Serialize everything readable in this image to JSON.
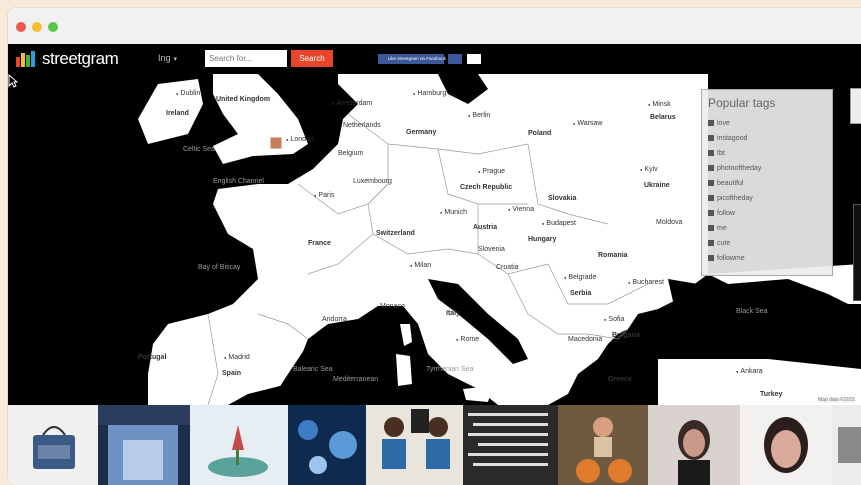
{
  "app": {
    "name": "streetgram",
    "language": "Ing",
    "search_placeholder": "Search for...",
    "search_button": "Search",
    "facebook_like": "Like streetgram on Facebook",
    "logo_colors": [
      "#e8452c",
      "#f5bf33",
      "#3bb54a",
      "#2d9cdb"
    ]
  },
  "tags_panel": {
    "title": "Popular tags",
    "tags": [
      "love",
      "instagood",
      "tbt",
      "photooftheday",
      "beautiful",
      "picoftheday",
      "follow",
      "me",
      "cute",
      "followme"
    ]
  },
  "map": {
    "labels": [
      {
        "text": "Dublin",
        "kind": "city"
      },
      {
        "text": "Ireland",
        "kind": "country"
      },
      {
        "text": "United Kingdom",
        "kind": "country"
      },
      {
        "text": "Amsterdam",
        "kind": "city"
      },
      {
        "text": "Hamburg",
        "kind": "city"
      },
      {
        "text": "Berlin",
        "kind": "city"
      },
      {
        "text": "Warsaw",
        "kind": "city"
      },
      {
        "text": "Minsk",
        "kind": "city"
      },
      {
        "text": "Belarus",
        "kind": "country"
      },
      {
        "text": "Germany",
        "kind": "country"
      },
      {
        "text": "Poland",
        "kind": "country"
      },
      {
        "text": "Netherlands",
        "kind": "country"
      },
      {
        "text": "Belgium",
        "kind": "country"
      },
      {
        "text": "Celtic Sea",
        "kind": "sea"
      },
      {
        "text": "London",
        "kind": "city"
      },
      {
        "text": "English Channel",
        "kind": "sea"
      },
      {
        "text": "Luxembourg",
        "kind": "country"
      },
      {
        "text": "Prague",
        "kind": "city"
      },
      {
        "text": "Czech Republic",
        "kind": "country"
      },
      {
        "text": "Kyiv",
        "kind": "city"
      },
      {
        "text": "Ukraine",
        "kind": "country"
      },
      {
        "text": "Paris",
        "kind": "city"
      },
      {
        "text": "Slovakia",
        "kind": "country"
      },
      {
        "text": "Munich",
        "kind": "city"
      },
      {
        "text": "Vienna",
        "kind": "city"
      },
      {
        "text": "Austria",
        "kind": "country"
      },
      {
        "text": "Budapest",
        "kind": "city"
      },
      {
        "text": "Moldova",
        "kind": "country"
      },
      {
        "text": "France",
        "kind": "country"
      },
      {
        "text": "Switzerland",
        "kind": "country"
      },
      {
        "text": "Hungary",
        "kind": "country"
      },
      {
        "text": "Slovenia",
        "kind": "country"
      },
      {
        "text": "Croatia",
        "kind": "country"
      },
      {
        "text": "Romania",
        "kind": "country"
      },
      {
        "text": "Bay of Biscay",
        "kind": "sea"
      },
      {
        "text": "Milan",
        "kind": "city"
      },
      {
        "text": "Belgrade",
        "kind": "city"
      },
      {
        "text": "Bucharest",
        "kind": "city"
      },
      {
        "text": "Serbia",
        "kind": "country"
      },
      {
        "text": "Monaco",
        "kind": "country"
      },
      {
        "text": "Andorra",
        "kind": "country"
      },
      {
        "text": "Italy",
        "kind": "country"
      },
      {
        "text": "Sofia",
        "kind": "city"
      },
      {
        "text": "Black Sea",
        "kind": "sea"
      },
      {
        "text": "Bulgaria",
        "kind": "country"
      },
      {
        "text": "Rome",
        "kind": "city"
      },
      {
        "text": "Macedonia",
        "kind": "country"
      },
      {
        "text": "Portugal",
        "kind": "country"
      },
      {
        "text": "Madrid",
        "kind": "city"
      },
      {
        "text": "Spain",
        "kind": "country"
      },
      {
        "text": "Balearic Sea",
        "kind": "sea"
      },
      {
        "text": "Tyrrhenian Sea",
        "kind": "sea"
      },
      {
        "text": "Mediterranean",
        "kind": "sea"
      },
      {
        "text": "Ankara",
        "kind": "city"
      },
      {
        "text": "Turkey",
        "kind": "country"
      },
      {
        "text": "Greece",
        "kind": "country"
      }
    ],
    "attribution": "Map data ©2015"
  },
  "photos": [
    {
      "subject": "handbag"
    },
    {
      "subject": "ice sculpture"
    },
    {
      "subject": "rose on plate"
    },
    {
      "subject": "blue crystals"
    },
    {
      "subject": "two women selfie"
    },
    {
      "subject": "arabic text"
    },
    {
      "subject": "girl with pumpkins"
    },
    {
      "subject": "woman portrait"
    },
    {
      "subject": "woman closeup"
    },
    {
      "subject": "gray photo"
    }
  ]
}
